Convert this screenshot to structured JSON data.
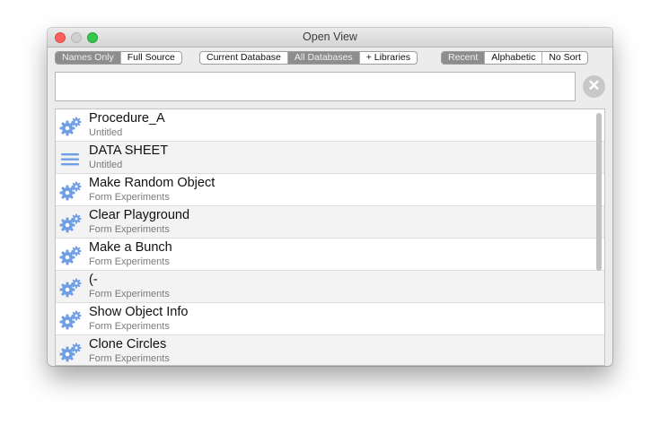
{
  "window": {
    "title": "Open View"
  },
  "filters": {
    "view_mode": [
      "Names Only",
      "Full Source"
    ],
    "view_mode_selected": 0,
    "database": [
      "Current Database",
      "All Databases",
      "+ Libraries"
    ],
    "database_selected": 1,
    "sort": [
      "Recent",
      "Alphabetic",
      "No Sort"
    ],
    "sort_selected": 0
  },
  "search": {
    "value": "",
    "placeholder": ""
  },
  "colors": {
    "icon_blue": "#6e9ee6",
    "selected_segment": "#8d8d8d"
  },
  "items": [
    {
      "name": "Procedure_A",
      "sub": "Untitled",
      "icon": "gears-icon"
    },
    {
      "name": "DATA SHEET",
      "sub": "Untitled",
      "icon": "lines-icon"
    },
    {
      "name": "Make Random Object",
      "sub": "Form Experiments",
      "icon": "gears-icon"
    },
    {
      "name": "Clear Playground",
      "sub": "Form Experiments",
      "icon": "gears-icon"
    },
    {
      "name": "Make a Bunch",
      "sub": "Form Experiments",
      "icon": "gears-icon"
    },
    {
      "name": "(-",
      "sub": "Form Experiments",
      "icon": "gears-icon"
    },
    {
      "name": "Show Object Info",
      "sub": "Form Experiments",
      "icon": "gears-icon"
    },
    {
      "name": "Clone Circles",
      "sub": "Form Experiments",
      "icon": "gears-icon"
    }
  ]
}
